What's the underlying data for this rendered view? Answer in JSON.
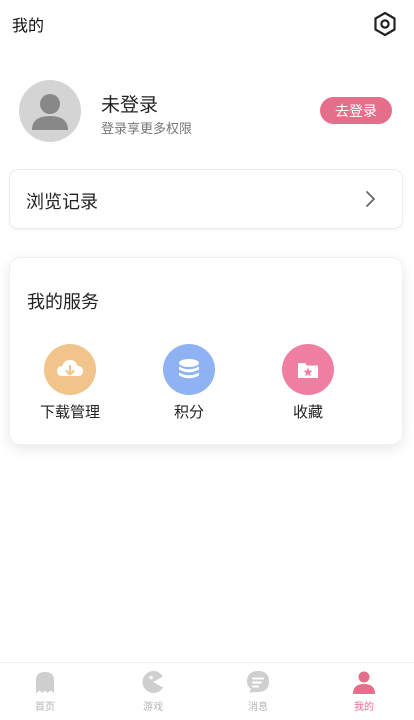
{
  "header": {
    "title": "我的",
    "settings_icon": "gear-icon"
  },
  "profile": {
    "status": "未登录",
    "hint": "登录享更多权限",
    "login_button": "去登录",
    "avatar_icon": "user-icon"
  },
  "history": {
    "label": "浏览记录",
    "arrow_icon": "chevron-right-icon"
  },
  "services": {
    "title": "我的服务",
    "items": [
      {
        "label": "下载管理",
        "icon": "download-cloud-icon",
        "color": "#f0c48a"
      },
      {
        "label": "积分",
        "icon": "coin-stack-icon",
        "color": "#8fb2f2"
      },
      {
        "label": "收藏",
        "icon": "star-folder-icon",
        "color": "#ee7fa1"
      }
    ]
  },
  "tabbar": {
    "active_color": "#e56f8b",
    "inactive_color": "#b5b5b5",
    "items": [
      {
        "label": "首页",
        "icon": "ghost-icon"
      },
      {
        "label": "游戏",
        "icon": "pacman-icon"
      },
      {
        "label": "消息",
        "icon": "message-icon"
      },
      {
        "label": "我的",
        "icon": "person-icon"
      }
    ]
  }
}
